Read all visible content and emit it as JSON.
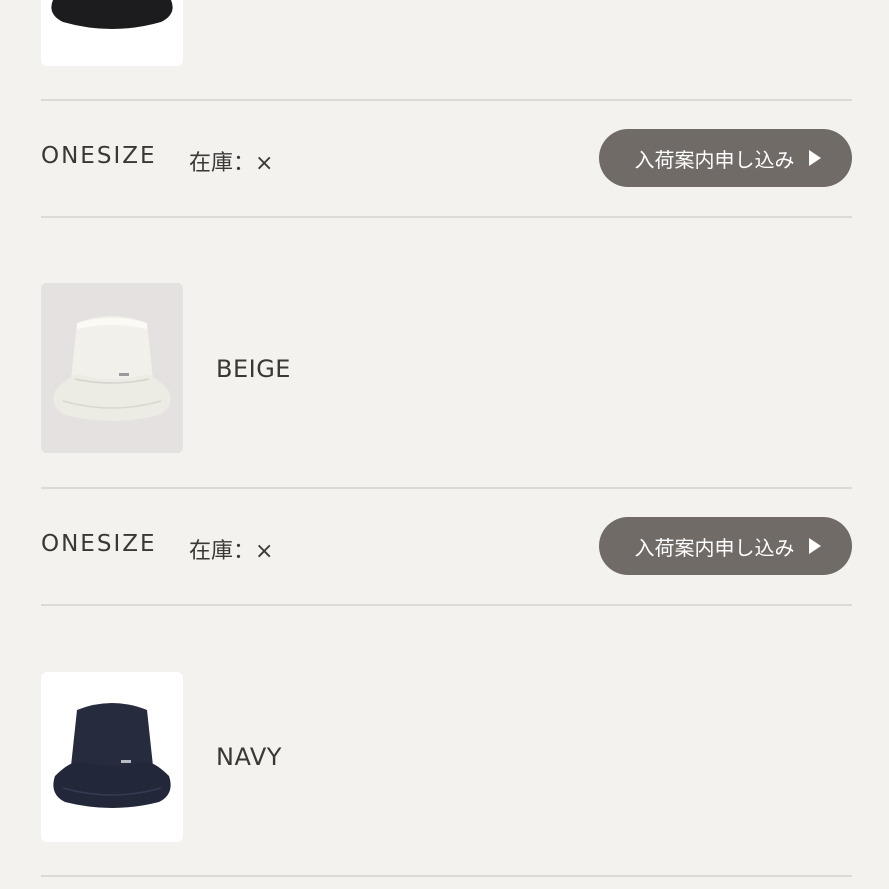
{
  "products": [
    {
      "color": "",
      "thumb_bg": "#ffffff",
      "hat_color": "#1c1c1e"
    },
    {
      "color": "BEIGE",
      "thumb_bg": "#e4e1e0",
      "hat_color": "#ecebe4"
    },
    {
      "color": "NAVY",
      "thumb_bg": "#ffffff",
      "hat_color": "#22283a"
    }
  ],
  "size_rows": [
    {
      "size": "ONESIZE",
      "stock": "在庫：×",
      "button_label": "入荷案内申し込み",
      "button_icon": "chevron-right-icon"
    },
    {
      "size": "ONESIZE",
      "stock": "在庫：×",
      "button_label": "入荷案内申し込み",
      "button_icon": "chevron-right-icon"
    }
  ],
  "colors": {
    "background": "#f3f2ee",
    "button": "#716b68",
    "divider": "#dcdad6",
    "text": "#3a3735"
  }
}
